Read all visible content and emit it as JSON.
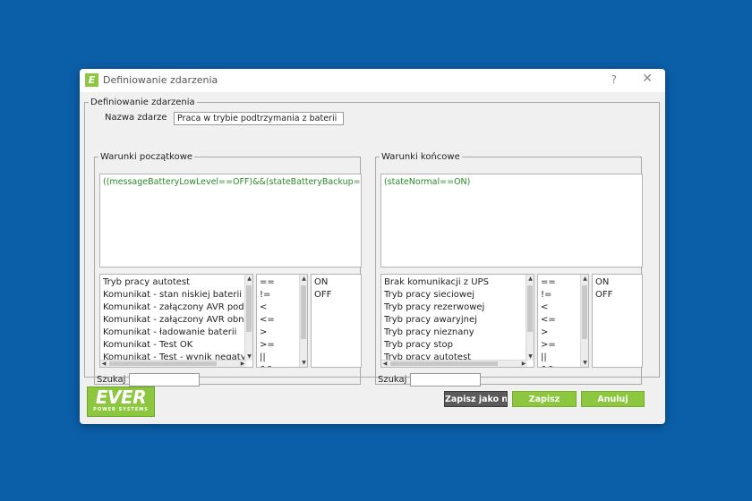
{
  "window": {
    "title": "Definiowanie zdarzenia",
    "help": "?",
    "close": "✕",
    "app_icon_letter": "E"
  },
  "main_group": {
    "legend": "Definiowanie zdarzenia",
    "event_name_label": "Nazwa zdarze",
    "event_name_value": "Praca w trybie podtrzymania z baterii"
  },
  "start_conditions": {
    "legend": "Warunki początkowe",
    "expression": "((messageBatteryLowLevel==OFF)&&(stateBatteryBackup==ON))",
    "items": [
      "Tryb pracy autotest",
      "Komunikat - stan niskiej baterii",
      "Komunikat - załączony AVR podw",
      "Komunikat - załączony AVR obniż",
      "Komunikat - ładowanie baterii",
      "Komunikat - Test OK",
      "Komunikat - Test - wynik negatywn"
    ],
    "operators": [
      "==",
      "!=",
      "<",
      "<=",
      ">",
      ">=",
      "||",
      "&&"
    ],
    "values": [
      "ON",
      "OFF"
    ],
    "search_label": "Szukaj",
    "search_value": ""
  },
  "end_conditions": {
    "legend": "Warunki końcowe",
    "expression": "(stateNormal==ON)",
    "items": [
      "Brak komunikacji z UPS",
      "Tryb pracy sieciowej",
      "Tryb pracy rezerwowej",
      "Tryb pracy awaryjnej",
      "Tryb pracy nieznany",
      "Tryb pracy stop",
      "Tryb pracy autotest"
    ],
    "operators": [
      "==",
      "!=",
      "<",
      "<=",
      ">",
      ">=",
      "||",
      "&&"
    ],
    "values": [
      "ON",
      "OFF"
    ],
    "search_label": "Szukaj",
    "search_value": ""
  },
  "logo": {
    "main": "EVER",
    "sub": "POWER SYSTEMS"
  },
  "buttons": {
    "save_as_new": "Zapisz jako nowy",
    "save": "Zapisz",
    "cancel": "Anuluj"
  },
  "colors": {
    "background": "#0a5fa8",
    "accent": "#8dc63f",
    "expression_text": "#2a8a2a"
  }
}
